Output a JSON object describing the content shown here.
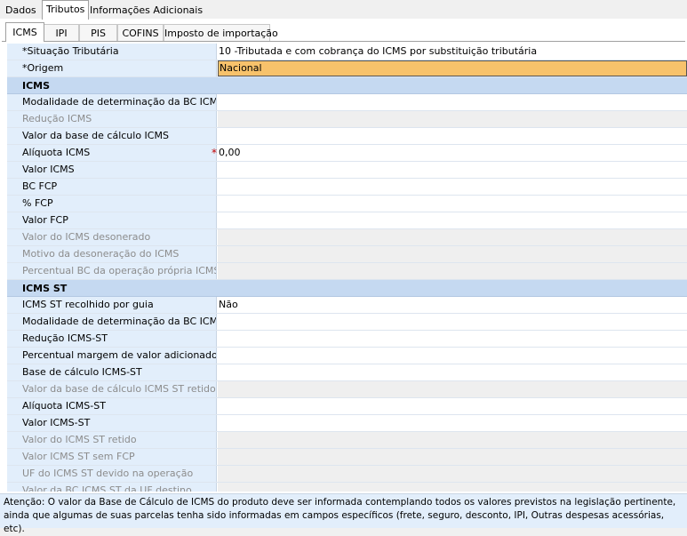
{
  "top_tabs": [
    {
      "label": "Dados"
    },
    {
      "label": "Tributos"
    },
    {
      "label": "Informações Adicionais"
    }
  ],
  "sub_tabs": [
    {
      "label": "ICMS"
    },
    {
      "label": "IPI"
    },
    {
      "label": "PIS"
    },
    {
      "label": "COFINS"
    },
    {
      "label": "Imposto de importação"
    }
  ],
  "header_rows": [
    {
      "label": "*Situação Tributária",
      "value": "10 -Tributada e com cobrança do ICMS por substituição tributária"
    },
    {
      "label": "*Origem",
      "value": "Nacional"
    }
  ],
  "icms": {
    "title": "ICMS",
    "rows": [
      {
        "label": "Modalidade de determinação da BC ICMS",
        "value": ""
      },
      {
        "label": "Redução ICMS",
        "value": ""
      },
      {
        "label": "Valor da base de cálculo ICMS",
        "value": ""
      },
      {
        "label": "Alíquota ICMS",
        "value": "0,00"
      },
      {
        "label": "Valor ICMS",
        "value": ""
      },
      {
        "label": "BC FCP",
        "value": ""
      },
      {
        "label": "% FCP",
        "value": ""
      },
      {
        "label": "Valor FCP",
        "value": ""
      },
      {
        "label": "Valor do ICMS desonerado",
        "value": ""
      },
      {
        "label": "Motivo da desoneração do ICMS",
        "value": ""
      },
      {
        "label": "Percentual BC da operação própria ICMS",
        "value": ""
      }
    ]
  },
  "icms_st": {
    "title": "ICMS ST",
    "rows": [
      {
        "label": "ICMS ST recolhido por guia",
        "value": "Não"
      },
      {
        "label": "Modalidade de determinação da BC ICMS ST",
        "value": ""
      },
      {
        "label": "Redução ICMS-ST",
        "value": ""
      },
      {
        "label": "Percentual margem de valor adicionado ICMS",
        "value": ""
      },
      {
        "label": "Base de cálculo ICMS-ST",
        "value": ""
      },
      {
        "label": "Valor da base de cálculo ICMS ST retido",
        "value": ""
      },
      {
        "label": "Alíquota ICMS-ST",
        "value": ""
      },
      {
        "label": "Valor ICMS-ST",
        "value": ""
      },
      {
        "label": "Valor do ICMS ST retido",
        "value": ""
      },
      {
        "label": "Valor ICMS ST sem FCP",
        "value": ""
      },
      {
        "label": "UF do ICMS ST devido na operação",
        "value": ""
      },
      {
        "label": "Valor da BC ICMS ST da UF destino",
        "value": ""
      }
    ]
  },
  "required_marker": "*",
  "note": {
    "line1": "Atenção: O valor da Base de Cálculo de ICMS do produto deve ser informada contemplando todos os valores previstos na legislação pertinente,",
    "line2": "ainda que algumas de suas parcelas tenha sido informadas em campos específicos (frete, seguro, desconto, IPI, Outras despesas acessórias, etc)."
  },
  "colors": {
    "label_bg": "#e2eefb",
    "section_bg": "#c5d9f1",
    "highlight": "#f7c26b",
    "disabled_bg": "#efefef",
    "required": "#c00000"
  }
}
